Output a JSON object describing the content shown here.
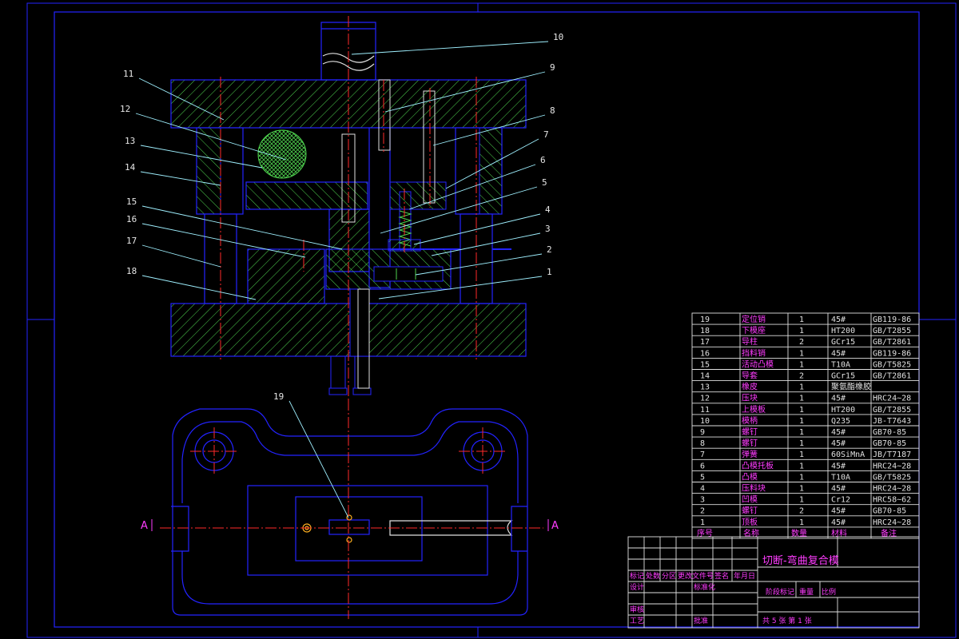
{
  "callouts": [
    {
      "num": "10"
    },
    {
      "num": "9"
    },
    {
      "num": "8"
    },
    {
      "num": "7"
    },
    {
      "num": "6"
    },
    {
      "num": "5"
    },
    {
      "num": "4"
    },
    {
      "num": "3"
    },
    {
      "num": "2"
    },
    {
      "num": "1"
    },
    {
      "num": "11"
    },
    {
      "num": "12"
    },
    {
      "num": "13"
    },
    {
      "num": "14"
    },
    {
      "num": "15"
    },
    {
      "num": "16"
    },
    {
      "num": "17"
    },
    {
      "num": "18"
    },
    {
      "num": "19"
    }
  ],
  "section_labels": {
    "left": "A",
    "right": "A"
  },
  "bom": {
    "rows": [
      {
        "no": "19",
        "name": "定位销",
        "qty": "1",
        "material": "45#",
        "note": "GB119-86"
      },
      {
        "no": "18",
        "name": "下模座",
        "qty": "1",
        "material": "HT200",
        "note": "GB/T2855"
      },
      {
        "no": "17",
        "name": "导柱",
        "qty": "2",
        "material": "GCr15",
        "note": "GB/T2861"
      },
      {
        "no": "16",
        "name": "挡料销",
        "qty": "1",
        "material": "45#",
        "note": "GB119-86"
      },
      {
        "no": "15",
        "name": "活动凸模",
        "qty": "1",
        "material": "T10A",
        "note": "GB/T5825"
      },
      {
        "no": "14",
        "name": "导套",
        "qty": "2",
        "material": "GCr15",
        "note": "GB/T2861"
      },
      {
        "no": "13",
        "name": "橡皮",
        "qty": "1",
        "material": "聚氨酯橡胶",
        "note": ""
      },
      {
        "no": "12",
        "name": "压块",
        "qty": "1",
        "material": "45#",
        "note": "HRC24~28"
      },
      {
        "no": "11",
        "name": "上模板",
        "qty": "1",
        "material": "HT200",
        "note": "GB/T2855"
      },
      {
        "no": "10",
        "name": "模柄",
        "qty": "1",
        "material": "Q235",
        "note": "JB-T7643"
      },
      {
        "no": "9",
        "name": "螺钉",
        "qty": "1",
        "material": "45#",
        "note": "GB70-85"
      },
      {
        "no": "8",
        "name": "螺钉",
        "qty": "1",
        "material": "45#",
        "note": "GB70-85"
      },
      {
        "no": "7",
        "name": "弹簧",
        "qty": "1",
        "material": "60SiMnA",
        "note": "JB/T7187"
      },
      {
        "no": "6",
        "name": "凸模托板",
        "qty": "1",
        "material": "45#",
        "note": "HRC24~28"
      },
      {
        "no": "5",
        "name": "凸模",
        "qty": "1",
        "material": "T10A",
        "note": "GB/T5825"
      },
      {
        "no": "4",
        "name": "压料块",
        "qty": "1",
        "material": "45#",
        "note": "HRC24~28"
      },
      {
        "no": "3",
        "name": "凹模",
        "qty": "1",
        "material": "Cr12",
        "note": "HRC58~62"
      },
      {
        "no": "2",
        "name": "螺钉",
        "qty": "2",
        "material": "45#",
        "note": "GB70-85"
      },
      {
        "no": "1",
        "name": "顶板",
        "qty": "1",
        "material": "45#",
        "note": "HRC24~28"
      }
    ],
    "header": {
      "no": "序号",
      "name": "名称",
      "qty": "数量",
      "material": "材料",
      "note": "备注"
    }
  },
  "title_block": {
    "drawing_title": "切断-弯曲复合模",
    "rev_headers": [
      "标记",
      "处数",
      "分区",
      "更改文件号",
      "签名",
      "年月日"
    ],
    "design": "设计",
    "standard": "标准化",
    "audit": "审核",
    "process": "工艺",
    "approve": "批准",
    "stage": "阶段标记",
    "weight": "重量",
    "scale": "比例",
    "sheets": "共 5 张 第 1 张"
  },
  "colors": {
    "frame": "#2323ff",
    "hatch": "#4ed24e",
    "center": "#ff2a2a",
    "callout_line": "#9ff0ff",
    "text": "#ff3cff"
  }
}
